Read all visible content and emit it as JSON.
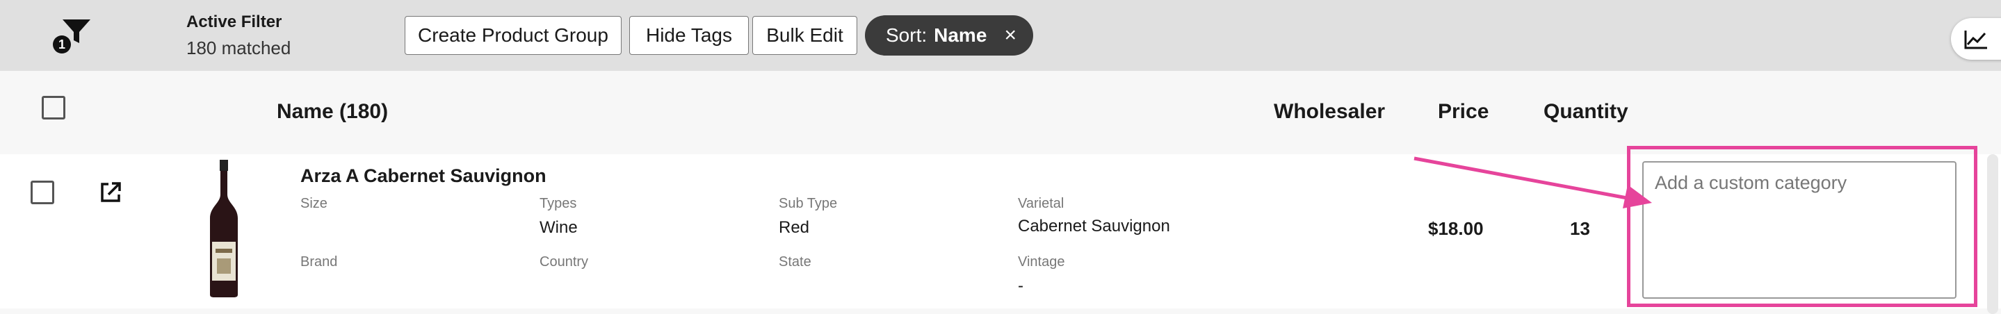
{
  "toolbar": {
    "filter_badge": "1",
    "filter_title": "Active Filter",
    "filter_count": "180 matched",
    "create_group_label": "Create Product Group",
    "hide_tags_label": "Hide Tags",
    "bulk_edit_label": "Bulk Edit",
    "sort_prefix": "Sort:",
    "sort_value": "Name",
    "sort_close": "×"
  },
  "table": {
    "headers": {
      "name": "Name  (180)",
      "wholesaler": "Wholesaler",
      "price": "Price",
      "quantity": "Quantity"
    },
    "rows": [
      {
        "name": "Arza A Cabernet Sauvignon",
        "attributes": {
          "size_label": "Size",
          "size_value": "",
          "types_label": "Types",
          "types_value": "Wine",
          "subtype_label": "Sub Type",
          "subtype_value": "Red",
          "varietal_label": "Varietal",
          "varietal_value": "Cabernet Sauvignon",
          "brand_label": "Brand",
          "brand_value": "",
          "country_label": "Country",
          "country_value": "",
          "state_label": "State",
          "state_value": "",
          "vintage_label": "Vintage",
          "vintage_value": "-"
        },
        "price": "$18.00",
        "quantity": "13",
        "custom_category_placeholder": "Add a custom category"
      }
    ]
  },
  "icons": {
    "filter": "filter-funnel-icon",
    "chart": "line-chart-icon",
    "external_link": "open-external-icon",
    "product_image": "wine-bottle-icon"
  },
  "colors": {
    "toolbar_bg": "#e0e0e0",
    "sort_chip_bg": "#3b3b3b",
    "annotation": "#e6449b"
  }
}
